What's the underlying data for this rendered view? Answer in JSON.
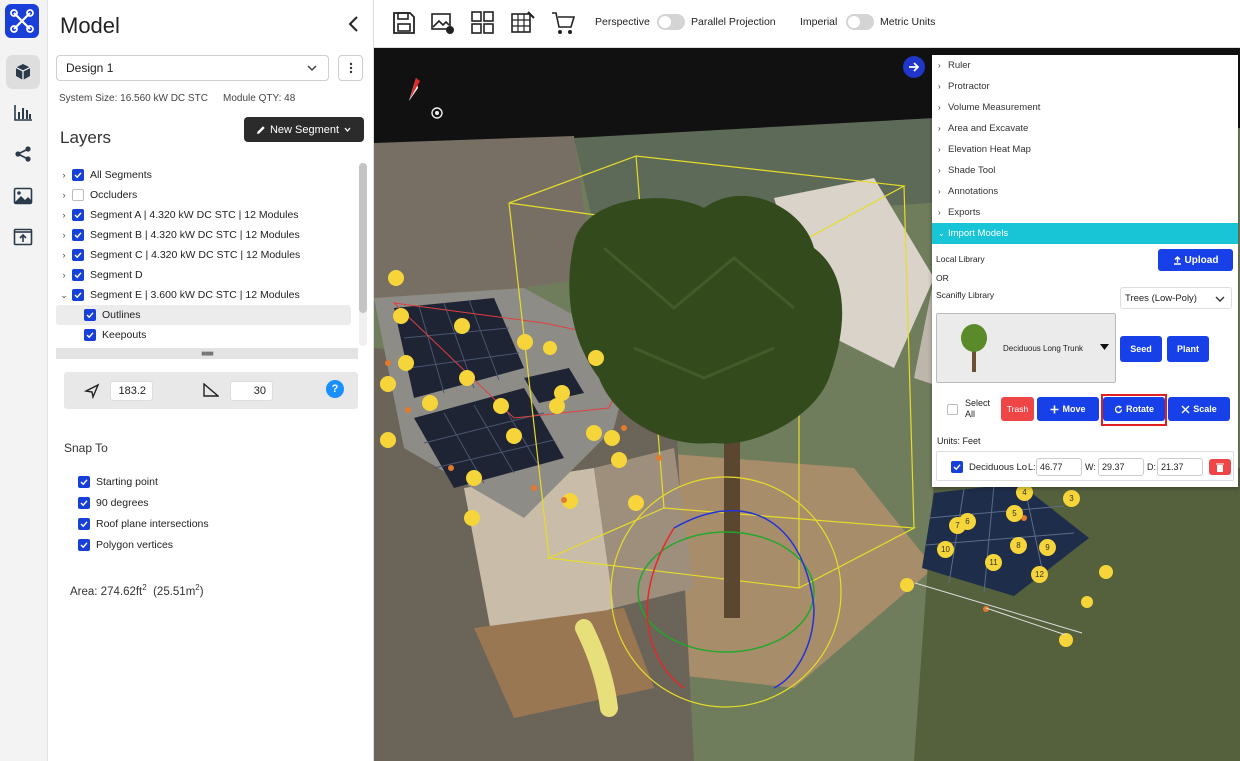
{
  "rail": {
    "icons": [
      "app-logo-icon",
      "cube-icon",
      "bar-chart-icon",
      "share-icon",
      "image-icon",
      "upload-icon"
    ]
  },
  "panel": {
    "title": "Model",
    "design": "Design 1",
    "system_size": "System Size: 16.560 kW DC STC",
    "module_qty": "Module QTY: 48",
    "layers_title": "Layers",
    "new_segment": "New Segment",
    "layers": [
      {
        "label": "All Segments",
        "checked": true,
        "expanded": false,
        "indent": 0
      },
      {
        "label": "Occluders",
        "checked": false,
        "expanded": false,
        "indent": 0
      },
      {
        "label": "Segment A | 4.320 kW DC STC | 12 Modules",
        "checked": true,
        "expanded": false,
        "indent": 0
      },
      {
        "label": "Segment B | 4.320 kW DC STC | 12 Modules",
        "checked": true,
        "expanded": false,
        "indent": 0
      },
      {
        "label": "Segment C | 4.320 kW DC STC | 12 Modules",
        "checked": true,
        "expanded": false,
        "indent": 0
      },
      {
        "label": "Segment D",
        "checked": true,
        "expanded": false,
        "indent": 0
      },
      {
        "label": "Segment E | 3.600 kW DC STC | 12 Modules",
        "checked": true,
        "expanded": true,
        "indent": 0
      },
      {
        "label": "Outlines",
        "checked": true,
        "expanded": false,
        "indent": 1,
        "selected": true
      },
      {
        "label": "Keepouts",
        "checked": true,
        "expanded": false,
        "indent": 1
      }
    ],
    "azimuth": "183.2",
    "pitch": "30",
    "help": "?",
    "snap_title": "Snap To",
    "snap": [
      {
        "label": "Starting point",
        "checked": true
      },
      {
        "label": "90 degrees",
        "checked": true
      },
      {
        "label": "Roof plane intersections",
        "checked": true
      },
      {
        "label": "Polygon vertices",
        "checked": true
      }
    ],
    "area_ft": "Area: 274.62ft",
    "area_m": "(25.51m",
    "area_sup": "2",
    "area_close": ")"
  },
  "toolbar": {
    "icons": [
      "save-icon",
      "image-settings-icon",
      "gallery-icon",
      "grid-edit-icon",
      "cart-icon"
    ],
    "perspective": "Perspective",
    "parallel": "Parallel Projection",
    "imperial": "Imperial",
    "metric": "Metric Units"
  },
  "scene": {
    "panel_numbers": [
      "3",
      "4",
      "5",
      "6",
      "7",
      "8",
      "9",
      "10",
      "11",
      "12"
    ]
  },
  "measure": {
    "items": [
      "Ruler",
      "Protractor",
      "Volume Measurement",
      "Area and Excavate",
      "Elevation Heat Map",
      "Shade Tool",
      "Annotations",
      "Exports"
    ],
    "open_item": "Import Models",
    "local_library": "Local Library",
    "upload": "Upload",
    "or": "OR",
    "scanifly_library": "Scanifly Library",
    "library_choice": "Trees (Low-Poly)",
    "model_name": "Deciduous Long Trunk",
    "seed": "Seed",
    "plant": "Plant",
    "select_all_1": "Select",
    "select_all_2": "All",
    "trash": "Trash",
    "move": "Move",
    "rotate": "Rotate",
    "scale": "Scale",
    "units": "Units: Feet",
    "instance_name": "Deciduous Lo",
    "l_label": "L:",
    "l_value": "46.77",
    "w_label": "W:",
    "w_value": "29.37",
    "d_label": "D:",
    "d_value": "21.37"
  },
  "colors": {
    "accent_blue": "#1740e8",
    "open_cyan": "#18c5d6",
    "danger_red": "#ee4646",
    "highlight_arrow": "#ff3b1a"
  }
}
